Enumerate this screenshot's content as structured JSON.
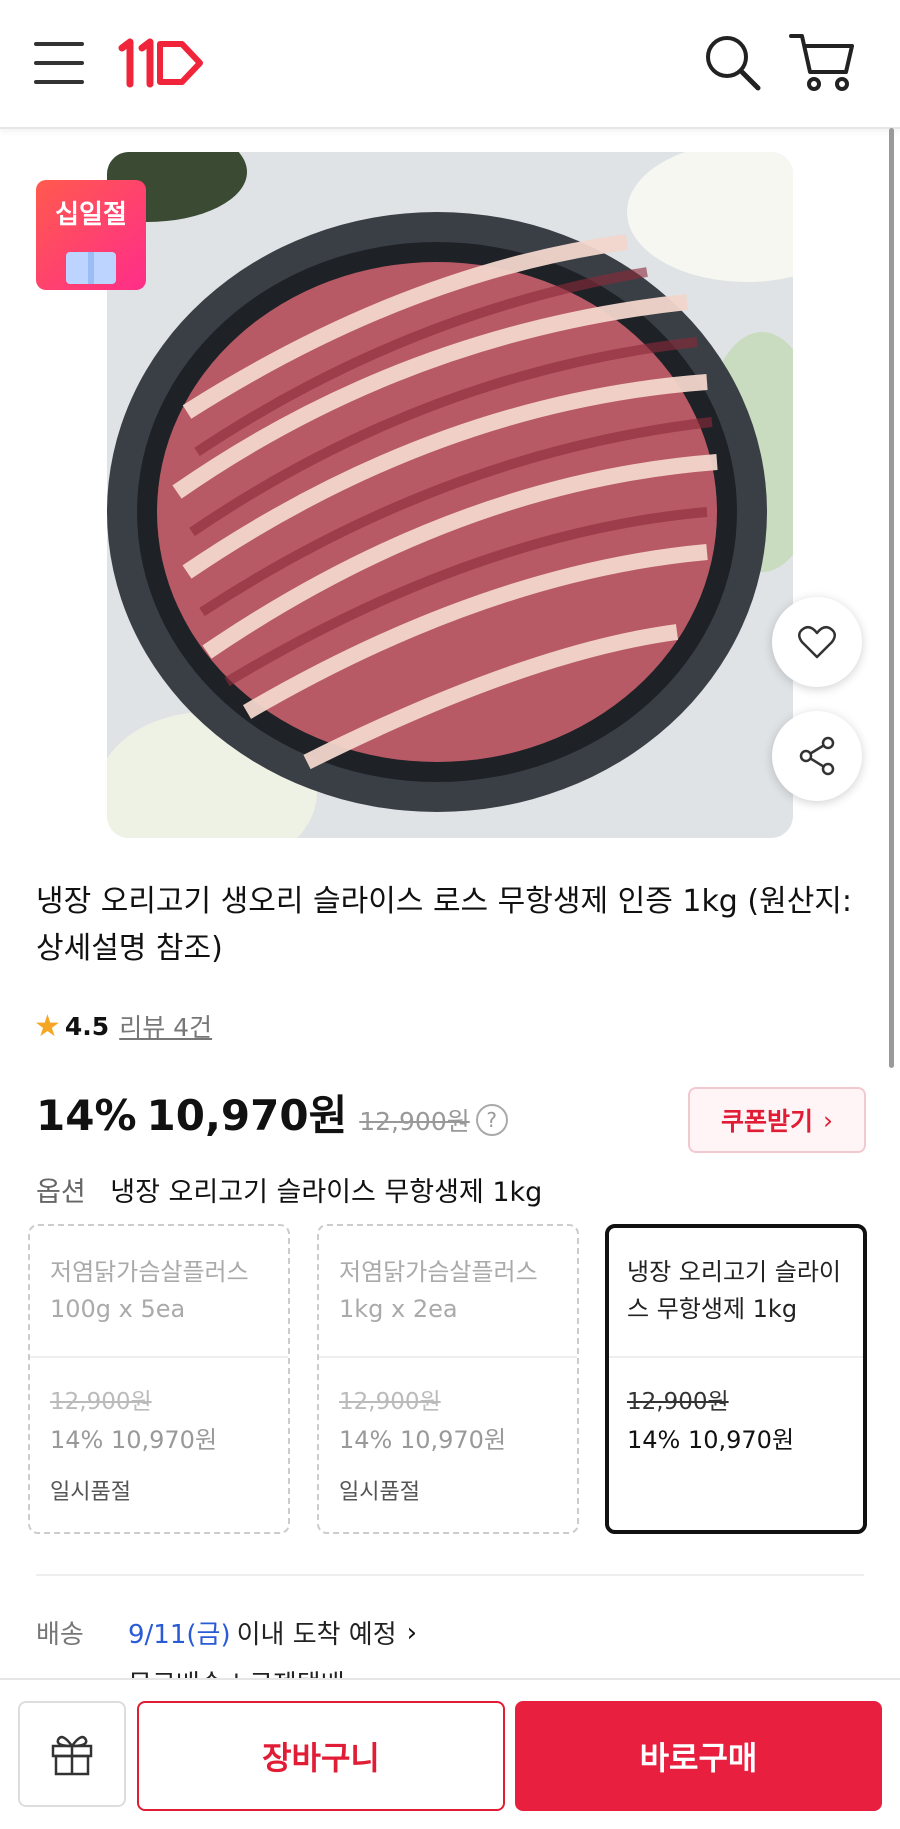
{
  "header": {
    "logo_text": "11",
    "icons": [
      "menu-icon",
      "search-icon",
      "cart-icon"
    ]
  },
  "badge": {
    "text": "십일절"
  },
  "product": {
    "title": "냉장 오리고기 생오리 슬라이스 로스 무항생제 인증 1kg (원산지: 상세설명 참조)",
    "rating": "4.5",
    "reviews": "리뷰 4건",
    "discount": "14%",
    "price": "10,970원",
    "original_price": "12,900원",
    "coupon_label": "쿠폰받기"
  },
  "option": {
    "label": "옵션",
    "selected": "냉장 오리고기 슬라이스 무항생제 1kg",
    "cards": [
      {
        "name": "저염닭가슴살플러스 100g x 5ea",
        "original": "12,900원",
        "price": "14% 10,970원",
        "status": "일시품절"
      },
      {
        "name": "저염닭가슴살플러스 1kg x 2ea",
        "original": "12,900원",
        "price": "14% 10,970원",
        "status": "일시품절"
      },
      {
        "name": "냉장 오리고기 슬라이스 무항생제 1kg",
        "original": "12,900원",
        "price": "14% 10,970원",
        "status": ""
      }
    ]
  },
  "shipping": {
    "label": "배송",
    "date": "9/11(금)",
    "rest": "이내 도착 예정",
    "sub": "무료배송 | 로젠택배"
  },
  "bottom_bar": {
    "cart": "장바구니",
    "buy": "바로구매"
  },
  "colors": {
    "accent": "#e81f3f",
    "link": "#2a5bd7",
    "star": "#f5a623"
  }
}
